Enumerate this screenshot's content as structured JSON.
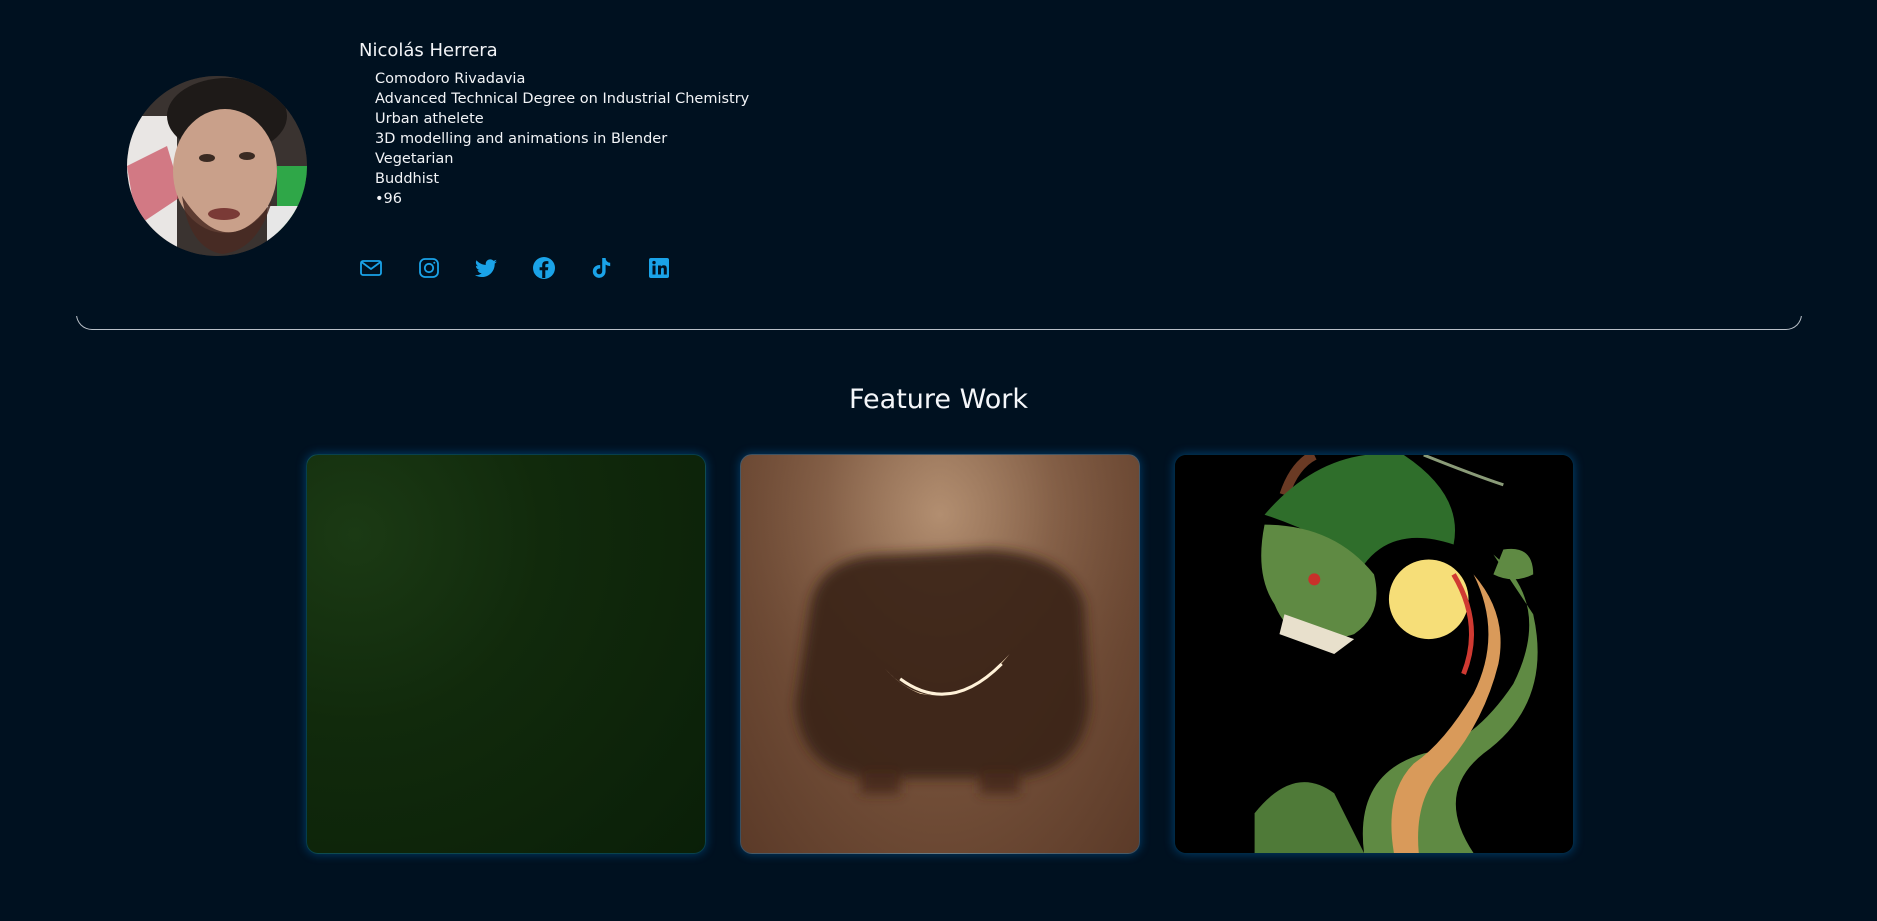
{
  "profile": {
    "name": "Nicolás Herrera",
    "details": [
      "Comodoro Rivadavia",
      "Advanced Technical Degree on Industrial Chemistry",
      "Urban athelete",
      "3D modelling and animations in Blender",
      "Vegetarian",
      "Buddhist",
      "•96"
    ],
    "avatar_icon": "avatar"
  },
  "socials": [
    {
      "icon": "mail-icon"
    },
    {
      "icon": "instagram-icon"
    },
    {
      "icon": "twitter-icon"
    },
    {
      "icon": "facebook-icon"
    },
    {
      "icon": "tiktok-icon"
    },
    {
      "icon": "linkedin-icon"
    }
  ],
  "feature": {
    "title": "Feature Work"
  },
  "colors": {
    "background": "#001120",
    "accent": "#1aa3e8",
    "text": "#f2f4f7"
  }
}
